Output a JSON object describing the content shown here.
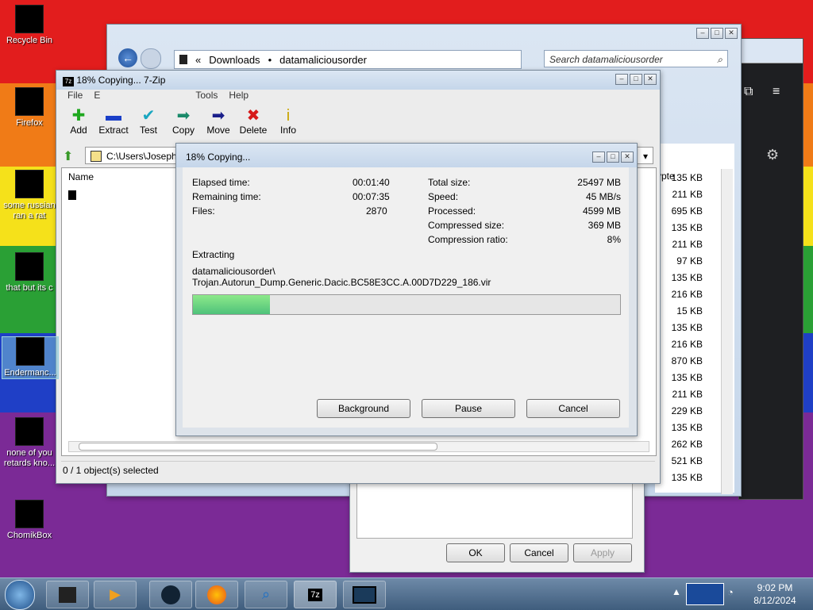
{
  "desktop_icons": [
    {
      "label": "Recycle Bin"
    },
    {
      "label": "Firefox"
    },
    {
      "label": "some russian ran a rat"
    },
    {
      "label": "that but its c"
    },
    {
      "label": "Endermanc..."
    },
    {
      "label": "none of you retards kno..."
    },
    {
      "label": "ChomikBox"
    }
  ],
  "explorer": {
    "breadcrumb_1": "Downloads",
    "breadcrumb_2": "datamaliciousorder",
    "search_placeholder": "Search datamaliciousorder",
    "sizes": [
      "135 KB",
      "211 KB",
      "695 KB",
      "135 KB",
      "211 KB",
      "97 KB",
      "135 KB",
      "216 KB",
      "15 KB",
      "135 KB",
      "216 KB",
      "870 KB",
      "135 KB",
      "211 KB",
      "229 KB",
      "135 KB",
      "262 KB",
      "521 KB",
      "135 KB"
    ],
    "type_header": "ypte"
  },
  "zip": {
    "title": "18% Copying... 7-Zip",
    "menu": [
      "File",
      "E",
      "Tools",
      "Help"
    ],
    "toolbar": [
      "Add",
      "Extract",
      "Test",
      "Copy",
      "Move",
      "Delete",
      "Info"
    ],
    "path": "C:\\Users\\Joseph",
    "name_header": "Name",
    "status": "0 / 1 object(s) selected"
  },
  "progress": {
    "title": "18% Copying...",
    "elapsed_label": "Elapsed time:",
    "elapsed_value": "00:01:40",
    "remaining_label": "Remaining time:",
    "remaining_value": "00:07:35",
    "files_label": "Files:",
    "files_value": "2870",
    "total_label": "Total size:",
    "total_value": "25497 MB",
    "speed_label": "Speed:",
    "speed_value": "45 MB/s",
    "processed_label": "Processed:",
    "processed_value": "4599 MB",
    "compressed_label": "Compressed size:",
    "compressed_value": "369 MB",
    "ratio_label": "Compression ratio:",
    "ratio_value": "8%",
    "action": "Extracting",
    "path_line1": "datamaliciousorder\\",
    "path_line2": "Trojan.Autorun_Dump.Generic.Dacic.BC58E3CC.A.00D7D229_186.vir",
    "percent": 18,
    "buttons": {
      "background": "Background",
      "pause": "Pause",
      "cancel": "Cancel"
    }
  },
  "props": {
    "ok": "OK",
    "cancel": "Cancel",
    "apply": "Apply"
  },
  "tray": {
    "time": "9:02 PM",
    "date": "8/12/2024"
  },
  "colors": {
    "progress_fill": "#7ee07a",
    "accent": "#3a6ea5"
  }
}
